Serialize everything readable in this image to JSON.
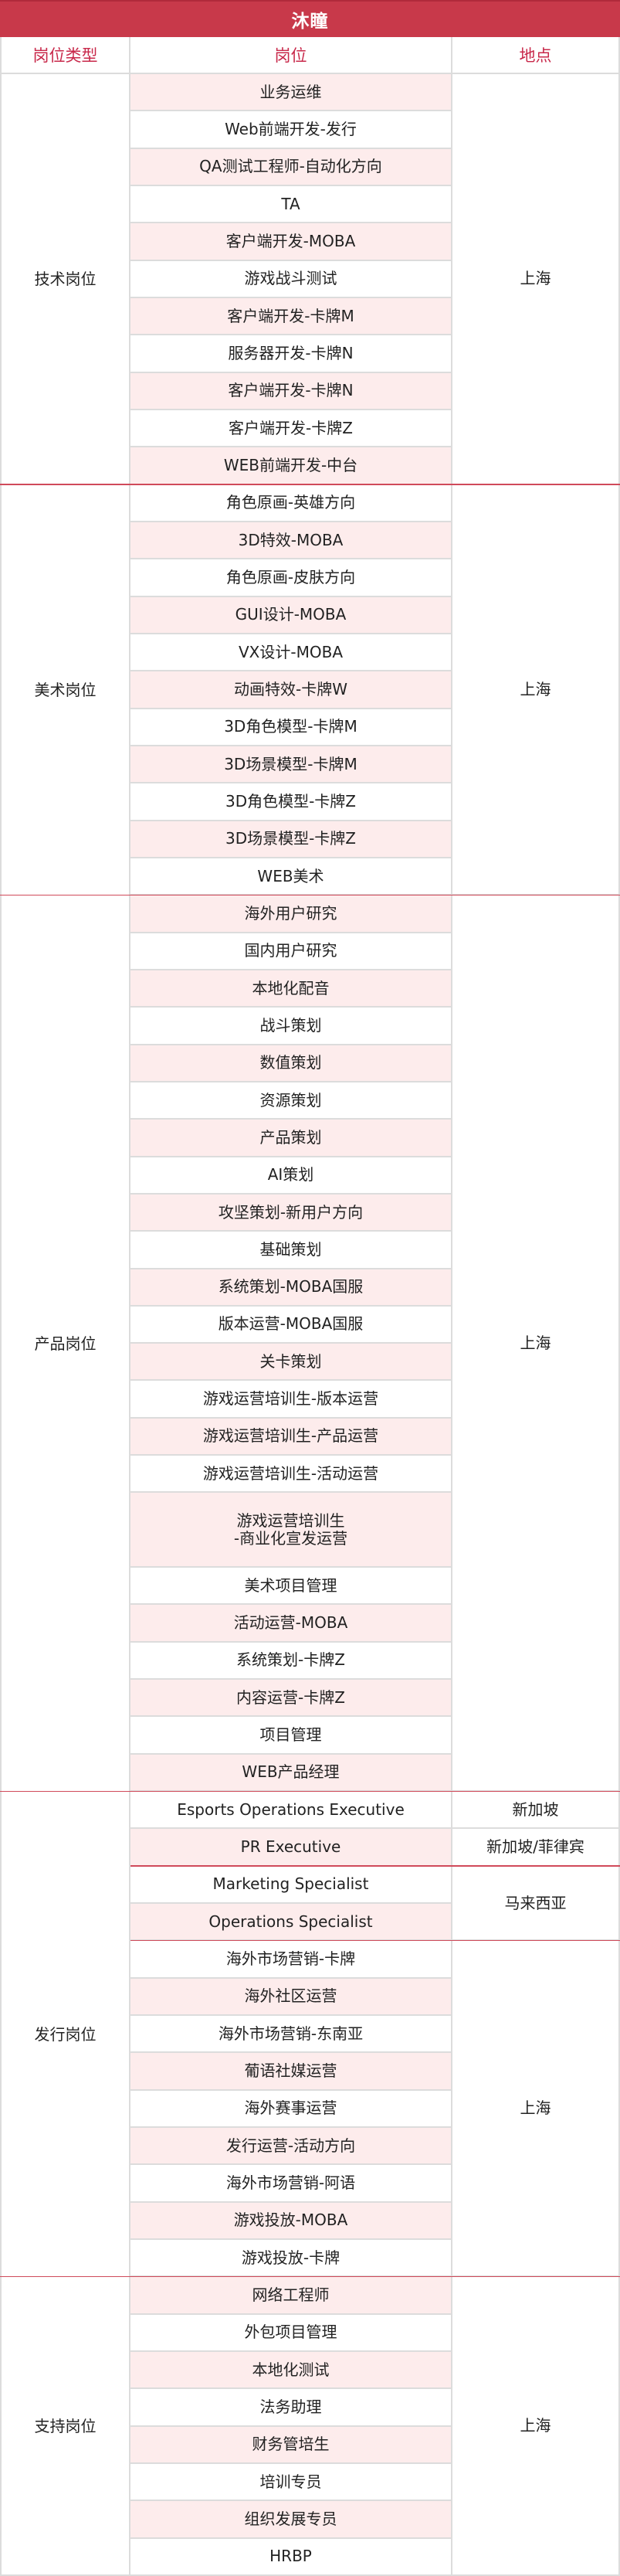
{
  "title": "沐瞳",
  "headers": {
    "category": "岗位类型",
    "position": "岗位",
    "location": "地点"
  },
  "colors": {
    "title_bg": "#c8394a",
    "header_text": "#c8284a",
    "row_pink": "#fdecec",
    "divider_red": "#d04a5a"
  },
  "sections": [
    {
      "category": "技术岗位",
      "groups": [
        {
          "location": "上海",
          "positions": [
            "业务运维",
            "Web前端开发-发行",
            "QA测试工程师-自动化方向",
            "TA",
            "客户端开发-MOBA",
            "游戏战斗测试",
            "客户端开发-卡牌M",
            "服务器开发-卡牌N",
            "客户端开发-卡牌N",
            "客户端开发-卡牌Z",
            "WEB前端开发-中台"
          ]
        }
      ]
    },
    {
      "category": "美术岗位",
      "groups": [
        {
          "location": "上海",
          "positions": [
            "角色原画-英雄方向",
            "3D特效-MOBA",
            "角色原画-皮肤方向",
            "GUI设计-MOBA",
            "VX设计-MOBA",
            "动画特效-卡牌W",
            "3D角色模型-卡牌M",
            "3D场景模型-卡牌M",
            "3D角色模型-卡牌Z",
            "3D场景模型-卡牌Z",
            "WEB美术"
          ]
        }
      ]
    },
    {
      "category": "产品岗位",
      "groups": [
        {
          "location": "上海",
          "positions": [
            "海外用户研究",
            "国内用户研究",
            "本地化配音",
            "战斗策划",
            "数值策划",
            "资源策划",
            "产品策划",
            "AI策划",
            "攻坚策划-新用户方向",
            "基础策划",
            "系统策划-MOBA国服",
            "版本运营-MOBA国服",
            "关卡策划",
            "游戏运营培训生-版本运营",
            "游戏运营培训生-产品运营",
            "游戏运营培训生-活动运营",
            "游戏运营培训生\n-商业化宣发运营",
            "美术项目管理",
            "活动运营-MOBA",
            "系统策划-卡牌Z",
            "内容运营-卡牌Z",
            "项目管理",
            "WEB产品经理"
          ]
        }
      ]
    },
    {
      "category": "发行岗位",
      "groups": [
        {
          "location": "新加坡",
          "positions": [
            "Esports Operations Executive"
          ]
        },
        {
          "location": "新加坡/菲律宾",
          "positions": [
            "PR Executive"
          ],
          "red_divider_after": true
        },
        {
          "location": "马来西亚",
          "positions": [
            "Marketing Specialist",
            "Operations Specialist"
          ],
          "red_divider_after": true
        },
        {
          "location": "上海",
          "positions": [
            "海外市场营销-卡牌",
            "海外社区运营",
            "海外市场营销-东南亚",
            "葡语社媒运营",
            "海外赛事运营",
            "发行运营-活动方向",
            "海外市场营销-阿语",
            "游戏投放-MOBA",
            "游戏投放-卡牌"
          ]
        }
      ]
    },
    {
      "category": "支持岗位",
      "groups": [
        {
          "location": "上海",
          "positions": [
            "网络工程师",
            "外包项目管理",
            "本地化测试",
            "法务助理",
            "财务管培生",
            "培训专员",
            "组织发展专员",
            "HRBP"
          ]
        }
      ]
    }
  ]
}
